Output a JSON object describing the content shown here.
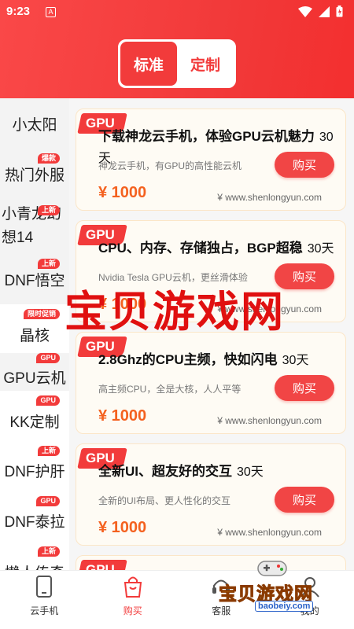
{
  "status": {
    "time": "9:23",
    "app_icon": "A"
  },
  "segment": {
    "standard": "标准",
    "custom": "定制"
  },
  "sidebar": {
    "items": [
      {
        "label": "小太阳",
        "tag": ""
      },
      {
        "label": "热门外服",
        "tag": "爆款"
      },
      {
        "label": "小青龙幻想14",
        "tag": "上新"
      },
      {
        "label": "DNF悟空",
        "tag": "上新"
      },
      {
        "label": "晶核",
        "tag": "限时促销"
      },
      {
        "label": "GPU云机",
        "tag": "GPU"
      },
      {
        "label": "KK定制",
        "tag": "GPU"
      },
      {
        "label": "DNF护肝",
        "tag": "上新"
      },
      {
        "label": "DNF泰拉",
        "tag": "GPU"
      },
      {
        "label": "懒人传奇",
        "tag": "上新"
      }
    ]
  },
  "cards": [
    {
      "badge": "GPU",
      "title": "下载神龙云手机，体验GPU云机魅力",
      "days": "30天",
      "desc": "神龙云手机，有GPU的高性能云机",
      "price": "¥ 1000",
      "site": "¥ www.shenlongyun.com",
      "buy": "购买"
    },
    {
      "badge": "GPU",
      "title": "CPU、内存、存储独占，BGP超稳",
      "days": "30天",
      "desc": "Nvidia Tesla GPU云机，更丝滑体验",
      "price": "¥ 1000",
      "site": "¥ www.shenlongyun.com",
      "buy": "购买"
    },
    {
      "badge": "GPU",
      "title": "2.8Ghz的CPU主频，快如闪电",
      "days": "30天",
      "desc": "高主频CPU，全是大核，人人平等",
      "price": "¥ 1000",
      "site": "¥ www.shenlongyun.com",
      "buy": "购买"
    },
    {
      "badge": "GPU",
      "title": "全新UI、超友好的交互",
      "days": "30天",
      "desc": "全新的UI布局、更人性化的交互",
      "price": "¥ 1000",
      "site": "¥ www.shenlongyun.com",
      "buy": "购买"
    },
    {
      "badge": "GPU",
      "title": "",
      "days": "",
      "desc": "",
      "price": "",
      "site": "",
      "buy": ""
    }
  ],
  "watermark": "宝贝游戏网",
  "tabbar": {
    "tabs": [
      {
        "label": "云手机",
        "icon": "phone-icon"
      },
      {
        "label": "购买",
        "icon": "shopping-bag-icon"
      },
      {
        "label": "客服",
        "icon": "headset-icon"
      },
      {
        "label": "我的",
        "icon": "user-icon"
      }
    ]
  },
  "logo": {
    "text": "宝贝游戏网",
    "url": "baobeiy.com"
  },
  "colors": {
    "primary": "#f23b3b",
    "price": "#f4611f",
    "card_bg": "#fefbf4"
  }
}
